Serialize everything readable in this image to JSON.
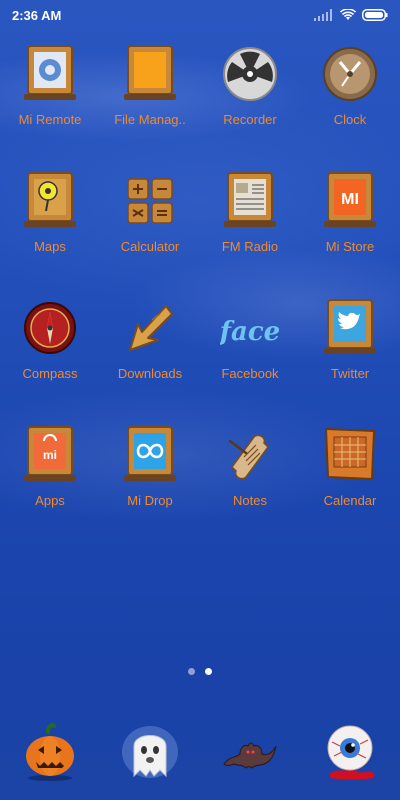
{
  "status_bar": {
    "time": "2:36 AM"
  },
  "apps": [
    {
      "label": "Mi Remote",
      "icon": "remote-icon"
    },
    {
      "label": "File Manag..",
      "icon": "folder-icon"
    },
    {
      "label": "Recorder",
      "icon": "reel-icon"
    },
    {
      "label": "Clock",
      "icon": "clock-icon"
    },
    {
      "label": "Maps",
      "icon": "map-pin-icon"
    },
    {
      "label": "Calculator",
      "icon": "calculator-icon"
    },
    {
      "label": "FM Radio",
      "icon": "radio-icon"
    },
    {
      "label": "Mi Store",
      "icon": "mi-store-icon"
    },
    {
      "label": "Compass",
      "icon": "compass-icon"
    },
    {
      "label": "Downloads",
      "icon": "download-arrow-icon"
    },
    {
      "label": "Facebook",
      "icon": "facebook-icon"
    },
    {
      "label": "Twitter",
      "icon": "twitter-bird-icon"
    },
    {
      "label": "Apps",
      "icon": "shopping-bag-icon"
    },
    {
      "label": "Mi Drop",
      "icon": "infinity-icon"
    },
    {
      "label": "Notes",
      "icon": "scroll-icon"
    },
    {
      "label": "Calendar",
      "icon": "calendar-icon"
    }
  ],
  "icon_text": {
    "mi": "MI",
    "face": "face",
    "apps_mi": "mi"
  },
  "dock": [
    {
      "icon": "pumpkin-icon"
    },
    {
      "icon": "ghost-icon"
    },
    {
      "icon": "bat-icon"
    },
    {
      "icon": "eyeball-icon"
    }
  ],
  "pages": {
    "count": 2,
    "active": 1
  },
  "colors": {
    "label": "#f08a2a",
    "wood": "#c8883a",
    "background": "#2350bb"
  }
}
